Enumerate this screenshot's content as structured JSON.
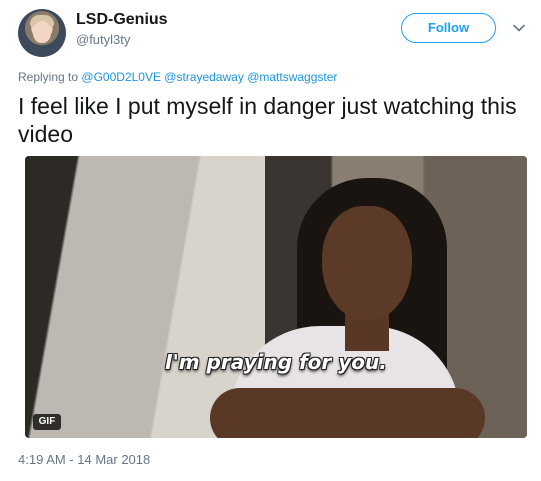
{
  "user": {
    "display_name": "LSD-Genius",
    "handle": "@futyl3ty"
  },
  "follow_label": "Follow",
  "reply": {
    "prefix": "Replying to",
    "mentions": [
      "@G00D2L0VE",
      "@strayedaway",
      "@mattswaggster"
    ]
  },
  "tweet_text": "I feel like I put myself in danger just watching this video",
  "media": {
    "caption": "I'm praying for you.",
    "badge": "GIF"
  },
  "timestamp": "4:19 AM - 14 Mar 2018",
  "colors": {
    "accent": "#1da1f2",
    "mention": "#1b95e0",
    "secondary_text": "#657786"
  }
}
